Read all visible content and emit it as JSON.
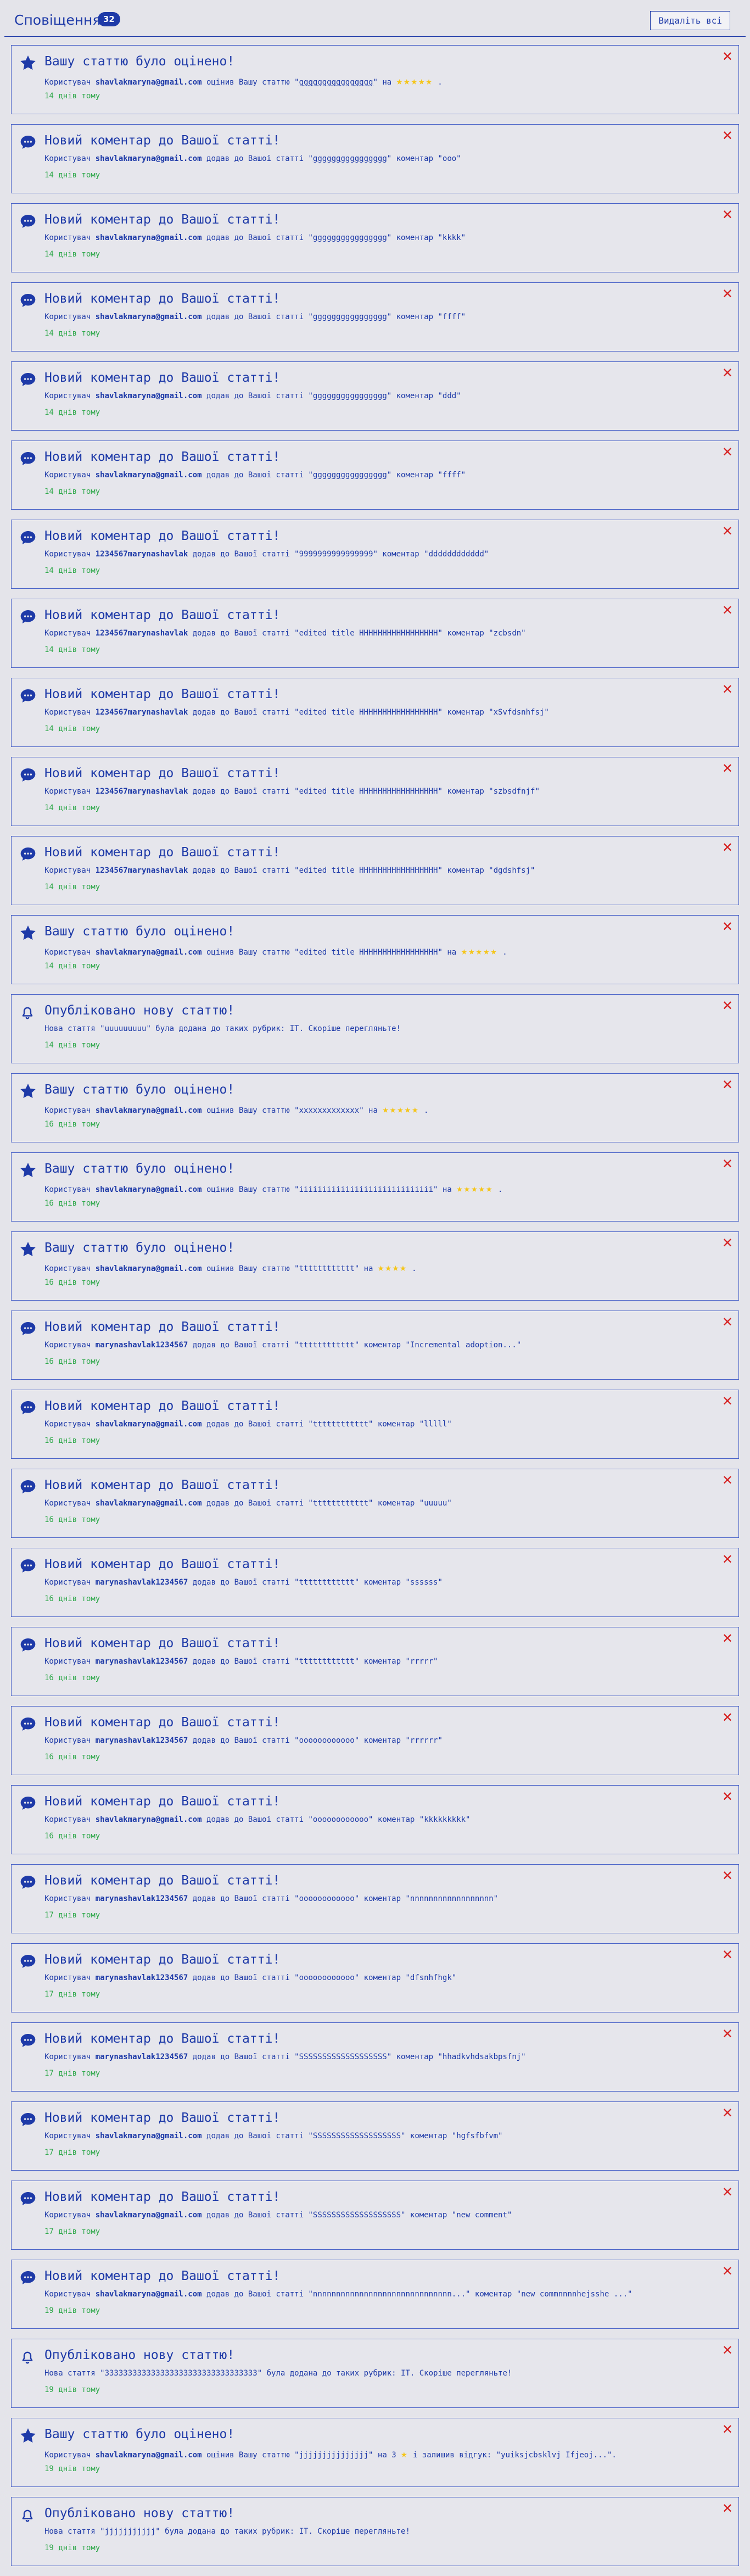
{
  "header": {
    "title": "Сповіщення",
    "count": "32",
    "delete_all": "Видаліть всі"
  },
  "notifications": [
    {
      "type": "rating",
      "title": "Вашу статтю було оцінено!",
      "pre": "Користувач ",
      "user": "shavlakmaryna@gmail.com",
      "mid": " оцінив Вашу статтю \"",
      "article": "gggggggggggggggg",
      "underline": true,
      "post": "\" на ",
      "stars": "★★★★★",
      "tail": " .",
      "time": "14 днів тому"
    },
    {
      "type": "comment",
      "title": "Новий коментар до Вашої статті!",
      "pre": "Користувач ",
      "user": "shavlakmaryna@gmail.com",
      "mid": " додав до Вашої статті \"",
      "article": "gggggggggggggggg",
      "underline": true,
      "post": "\" коментар \"ooo\"",
      "time": "14 днів тому"
    },
    {
      "type": "comment",
      "title": "Новий коментар до Вашої статті!",
      "pre": "Користувач ",
      "user": "shavlakmaryna@gmail.com",
      "mid": " додав до Вашої статті \"",
      "article": "gggggggggggggggg",
      "underline": true,
      "post": "\" коментар \"kkkk\"",
      "time": "14 днів тому"
    },
    {
      "type": "comment",
      "title": "Новий коментар до Вашої статті!",
      "pre": "Користувач ",
      "user": "shavlakmaryna@gmail.com",
      "mid": " додав до Вашої статті \"",
      "article": "gggggggggggggggg",
      "underline": true,
      "post": "\" коментар \"ffff\"",
      "time": "14 днів тому"
    },
    {
      "type": "comment",
      "title": "Новий коментар до Вашої статті!",
      "pre": "Користувач ",
      "user": "shavlakmaryna@gmail.com",
      "mid": " додав до Вашої статті \"",
      "article": "gggggggggggggggg",
      "underline": true,
      "post": "\" коментар \"ddd\"",
      "time": "14 днів тому"
    },
    {
      "type": "comment",
      "title": "Новий коментар до Вашої статті!",
      "pre": "Користувач ",
      "user": "shavlakmaryna@gmail.com",
      "mid": " додав до Вашої статті \"",
      "article": "gggggggggggggggg",
      "underline": true,
      "post": "\" коментар \"ffff\"",
      "time": "14 днів тому"
    },
    {
      "type": "comment",
      "title": "Новий коментар до Вашої статті!",
      "pre": "Користувач ",
      "user": "1234567marynashavlak",
      "mid": " додав до Вашої статті \"",
      "article": "9999999999999999",
      "post": "\" коментар \"dddddddddddd\"",
      "time": "14 днів тому"
    },
    {
      "type": "comment",
      "title": "Новий коментар до Вашої статті!",
      "pre": "Користувач ",
      "user": "1234567marynashavlak",
      "mid": " додав до Вашої статті \"",
      "article": "edited title HHHHHHHHHHHHHHHHH",
      "post": "\" коментар \"zcbsdn\"",
      "time": "14 днів тому"
    },
    {
      "type": "comment",
      "title": "Новий коментар до Вашої статті!",
      "pre": "Користувач ",
      "user": "1234567marynashavlak",
      "mid": " додав до Вашої статті \"",
      "article": "edited title HHHHHHHHHHHHHHHHH",
      "post": "\" коментар \"xSvfdsnhfsj\"",
      "time": "14 днів тому"
    },
    {
      "type": "comment",
      "title": "Новий коментар до Вашої статті!",
      "pre": "Користувач ",
      "user": "1234567marynashavlak",
      "mid": " додав до Вашої статті \"",
      "article": "edited title HHHHHHHHHHHHHHHHH",
      "post": "\" коментар \"szbsdfnjf\"",
      "time": "14 днів тому"
    },
    {
      "type": "comment",
      "title": "Новий коментар до Вашої статті!",
      "pre": "Користувач ",
      "user": "1234567marynashavlak",
      "mid": " додав до Вашої статті \"",
      "article": "edited title HHHHHHHHHHHHHHHHH",
      "post": "\" коментар \"dgdshfsj\"",
      "time": "14 днів тому"
    },
    {
      "type": "rating",
      "title": "Вашу статтю було оцінено!",
      "pre": "Користувач ",
      "user": "shavlakmaryna@gmail.com",
      "mid": " оцінив Вашу статтю \"",
      "article": "edited title HHHHHHHHHHHHHHHHH",
      "post": "\" на ",
      "stars": "★★★★★",
      "tail": " .",
      "time": "14 днів тому"
    },
    {
      "type": "publish",
      "title": "Опубліковано нову статтю!",
      "pre": "Нова стаття \"",
      "article": "uuuuuuuuu",
      "post": "\" була додана до таких рубрик: IT. Скоріше перегляньте!",
      "time": "14 днів тому"
    },
    {
      "type": "rating",
      "title": "Вашу статтю було оцінено!",
      "pre": "Користувач ",
      "user": "shavlakmaryna@gmail.com",
      "mid": " оцінив Вашу статтю \"",
      "article": "xxxxxxxxxxxxx",
      "post": "\" на ",
      "stars": "★★★★★",
      "tail": " .",
      "time": "16 днів тому"
    },
    {
      "type": "rating",
      "title": "Вашу статтю було оцінено!",
      "pre": "Користувач ",
      "user": "shavlakmaryna@gmail.com",
      "mid": " оцінив Вашу статтю \"",
      "article": "iiiiiiiiiiiiiiiiiiiiiiiiiiiii",
      "post": "\" на ",
      "stars": "★★★★★",
      "tail": " .",
      "time": "16 днів тому"
    },
    {
      "type": "rating",
      "title": "Вашу статтю було оцінено!",
      "pre": "Користувач ",
      "user": "shavlakmaryna@gmail.com",
      "mid": " оцінив Вашу статтю \"",
      "article": "tttttttttttt",
      "post": "\" на ",
      "stars": "★★★★",
      "tail": " .",
      "time": "16 днів тому"
    },
    {
      "type": "comment",
      "title": "Новий коментар до Вашої статті!",
      "pre": "Користувач ",
      "user": "marynashavlak1234567",
      "mid": " додав до Вашої статті \"",
      "article": "tttttttttttt",
      "post": "\" коментар \"Incremental adoption...\"",
      "time": "16 днів тому"
    },
    {
      "type": "comment",
      "title": "Новий коментар до Вашої статті!",
      "pre": "Користувач ",
      "user": "shavlakmaryna@gmail.com",
      "mid": " додав до Вашої статті \"",
      "article": "tttttttttttt",
      "post": "\" коментар \"lllll\"",
      "time": "16 днів тому"
    },
    {
      "type": "comment",
      "title": "Новий коментар до Вашої статті!",
      "pre": "Користувач ",
      "user": "shavlakmaryna@gmail.com",
      "mid": " додав до Вашої статті \"",
      "article": "tttttttttttt",
      "post": "\" коментар \"uuuuu\"",
      "time": "16 днів тому"
    },
    {
      "type": "comment",
      "title": "Новий коментар до Вашої статті!",
      "pre": "Користувач ",
      "user": "marynashavlak1234567",
      "mid": " додав до Вашої статті \"",
      "article": "tttttttttttt",
      "post": "\" коментар \"ssssss\"",
      "time": "16 днів тому"
    },
    {
      "type": "comment",
      "title": "Новий коментар до Вашої статті!",
      "pre": "Користувач ",
      "user": "marynashavlak1234567",
      "mid": " додав до Вашої статті \"",
      "article": "tttttttttttt",
      "post": "\" коментар \"rrrrr\"",
      "time": "16 днів тому"
    },
    {
      "type": "comment",
      "title": "Новий коментар до Вашої статті!",
      "pre": "Користувач ",
      "user": "marynashavlak1234567",
      "mid": " додав до Вашої статті \"",
      "article": "oooooooooooo",
      "post": "\" коментар \"rrrrrr\"",
      "time": "16 днів тому"
    },
    {
      "type": "comment",
      "title": "Новий коментар до Вашої статті!",
      "pre": "Користувач ",
      "user": "shavlakmaryna@gmail.com",
      "mid": " додав до Вашої статті \"",
      "article": "oooooooooooo",
      "post": "\" коментар \"kkkkkkkkk\"",
      "time": "16 днів тому"
    },
    {
      "type": "comment",
      "title": "Новий коментар до Вашої статті!",
      "pre": "Користувач ",
      "user": "marynashavlak1234567",
      "mid": " додав до Вашої статті \"",
      "article": "oooooooooooo",
      "post": "\" коментар \"nnnnnnnnnnnnnnnnnn\"",
      "time": "17 днів тому"
    },
    {
      "type": "comment",
      "title": "Новий коментар до Вашої статті!",
      "pre": "Користувач ",
      "user": "marynashavlak1234567",
      "mid": " додав до Вашої статті \"",
      "article": "oooooooooooo",
      "post": "\" коментар \"dfsnhfhgk\"",
      "time": "17 днів тому"
    },
    {
      "type": "comment",
      "title": "Новий коментар до Вашої статті!",
      "pre": "Користувач ",
      "user": "marynashavlak1234567",
      "mid": " додав до Вашої статті \"",
      "article": "SSSSSSSSSSSSSSSSSSS",
      "post": "\" коментар \"hhadkvhdsakbpsfnj\"",
      "time": "17 днів тому"
    },
    {
      "type": "comment",
      "title": "Новий коментар до Вашої статті!",
      "pre": "Користувач ",
      "user": "shavlakmaryna@gmail.com",
      "mid": " додав до Вашої статті \"",
      "article": "SSSSSSSSSSSSSSSSSSS",
      "post": "\" коментар \"hgfsfbfvm\"",
      "time": "17 днів тому"
    },
    {
      "type": "comment",
      "title": "Новий коментар до Вашої статті!",
      "pre": "Користувач ",
      "user": "shavlakmaryna@gmail.com",
      "mid": " додав до Вашої статті \"",
      "article": "SSSSSSSSSSSSSSSSSSS",
      "post": "\" коментар \"new comment\"",
      "time": "17 днів тому"
    },
    {
      "type": "comment",
      "title": "Новий коментар до Вашої статті!",
      "pre": "Користувач ",
      "user": "shavlakmaryna@gmail.com",
      "mid": " додав до Вашої статті \"",
      "article": "nnnnnnnnnnnnnnnnnnnnnnnnnnnnnn...",
      "post": "\" коментар \"new commnnnnhejsshe ...\"",
      "time": "19 днів тому"
    },
    {
      "type": "publish",
      "title": "Опубліковано нову статтю!",
      "pre": "Нова стаття \"",
      "article": "333333333333333333333333333333333",
      "post": "\" була додана до таких рубрик: IT. Скоріше перегляньте!",
      "time": "19 днів тому"
    },
    {
      "type": "rating",
      "title": "Вашу статтю було оцінено!",
      "pre": "Користувач ",
      "user": "shavlakmaryna@gmail.com",
      "mid": " оцінив Вашу статтю \"",
      "article": "jjjjjjjjjjjjjjj",
      "post": "\" на 3 ",
      "stars": "★",
      "tail": " і залишив відгук: \"yuiksjcbsklvj Ifjeoj...\".",
      "time": "19 днів тому"
    },
    {
      "type": "publish",
      "title": "Опубліковано нову статтю!",
      "pre": "Нова стаття \"",
      "article": "jjjjjjjjjjj",
      "post": "\" була додана до таких рубрик: IT. Скоріше перегляньте!",
      "time": "19 днів тому"
    }
  ]
}
